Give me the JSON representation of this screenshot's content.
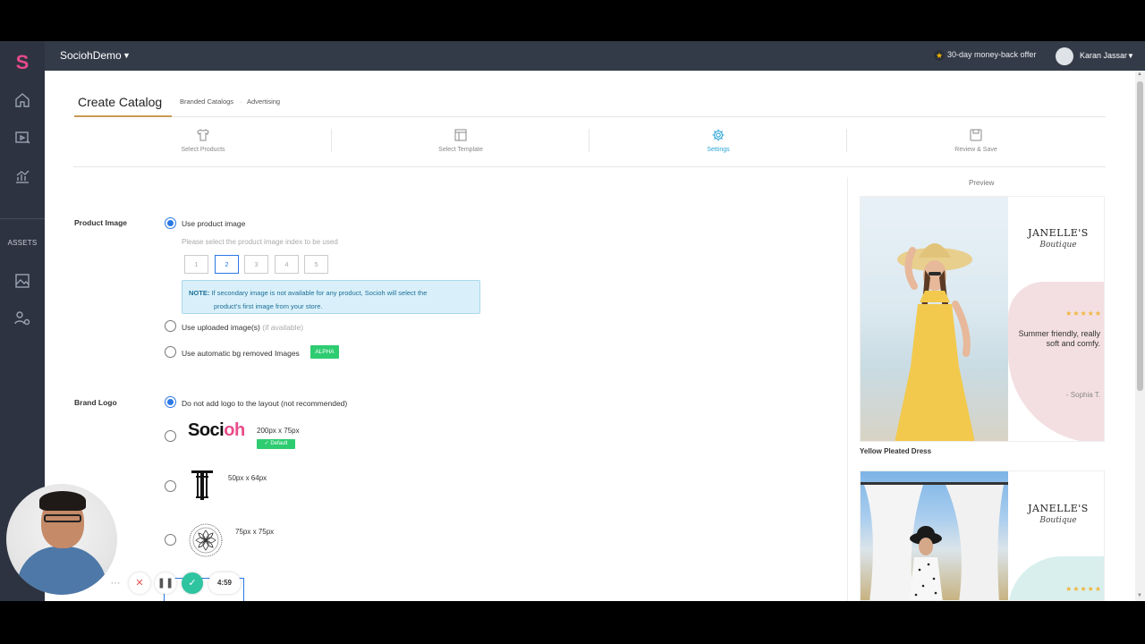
{
  "topbar": {
    "brand": "SociohDemo",
    "offer": "30-day money-back offer",
    "user_name": "Karan Jassar"
  },
  "sidebar": {
    "logo": "S",
    "assets_label": "ASSETS",
    "icons": [
      "home-icon",
      "media-icon",
      "analytics-icon",
      "image-assets-icon",
      "settings-assets-icon"
    ]
  },
  "header": {
    "title": "Create Catalog",
    "crumbs": [
      "Branded Catalogs",
      "Advertising"
    ]
  },
  "steps": [
    {
      "label": "Select Products",
      "icon": "tshirt-icon",
      "active": false
    },
    {
      "label": "Select Template",
      "icon": "template-icon",
      "active": false
    },
    {
      "label": "Settings",
      "icon": "gear-icon",
      "active": true
    },
    {
      "label": "Review & Save",
      "icon": "save-icon",
      "active": false
    }
  ],
  "product_image": {
    "label": "Product Image",
    "opt_product": "Use product image",
    "hint": "Please select the product image index to be used",
    "indexes": [
      "1",
      "2",
      "3",
      "4",
      "5"
    ],
    "selected_index": "2",
    "note_bold": "NOTE:",
    "note_line1": "If secondary image is not available for any product, Socioh will select the",
    "note_line2": "product's first image from your store.",
    "opt_uploaded": "Use uploaded image(s)",
    "opt_uploaded_suffix": "(if available)",
    "opt_bg_removed": "Use automatic bg removed Images",
    "alpha_badge": "ALPHA"
  },
  "brand_logo": {
    "label": "Brand Logo",
    "opt_none": "Do not add logo to the layout (not recommended)",
    "logo1_text_a": "Soci",
    "logo1_text_b": "oh",
    "logo1_dim": "200px x 75px",
    "default_badge": "✓ Default",
    "logo2_dim": "50px x 64px",
    "logo3_dim": "75px x 75px"
  },
  "preview": {
    "label": "Preview",
    "card_brand": "JANELLE'S",
    "card_sub": "Boutique",
    "stars": "★★★★★",
    "quote": "Summer friendly, really soft and comfy.",
    "author": "- Sophia T.",
    "product_name": "Yellow Pleated Dress"
  },
  "recorder": {
    "timer": "4:59",
    "more": "···"
  },
  "colors": {
    "accent": "#2aa5d8",
    "radio": "#2b78e4",
    "topbar": "#343b48",
    "sidebar": "#2d3340",
    "badge_green": "#2ecc71"
  }
}
